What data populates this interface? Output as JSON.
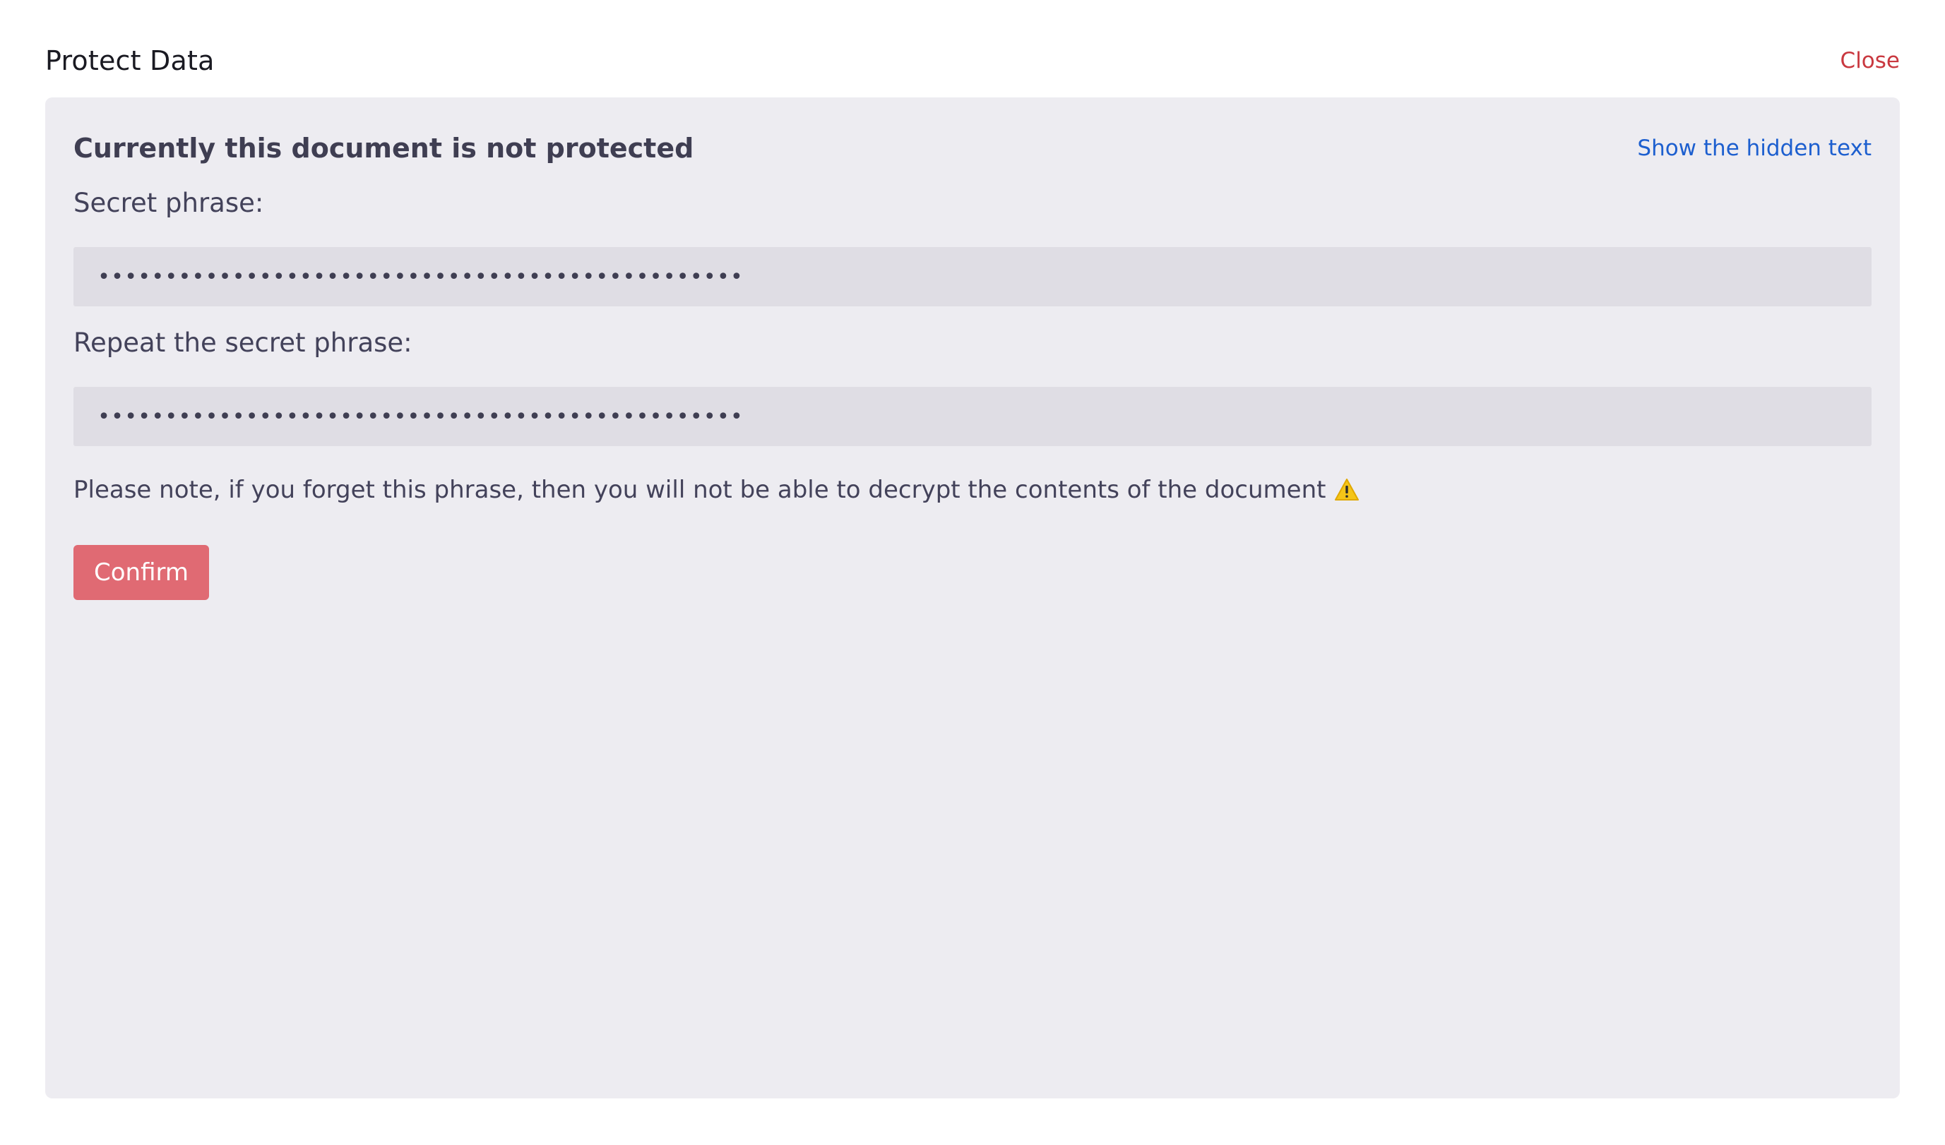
{
  "modal": {
    "title": "Protect Data",
    "close_label": "Close"
  },
  "panel": {
    "status_heading": "Currently this document is not protected",
    "show_hidden_link": "Show the hidden text",
    "secret_label": "Secret phrase:",
    "secret_value": "••••••••••••••••••••••••••••••••••••••••••••••••",
    "repeat_label": "Repeat the secret phrase:",
    "repeat_value": "••••••••••••••••••••••••••••••••••••••••••••••••",
    "note": "Please note, if you forget this phrase, then you will not be able to decrypt the contents of the document",
    "note_icon": "warning-icon",
    "confirm_label": "Confirm"
  },
  "colors": {
    "panel_bg": "#edecf1",
    "close_red": "#c9383f",
    "link_blue": "#1d5fcf",
    "confirm_bg": "#e06a73",
    "warning_yellow": "#f5c518"
  }
}
